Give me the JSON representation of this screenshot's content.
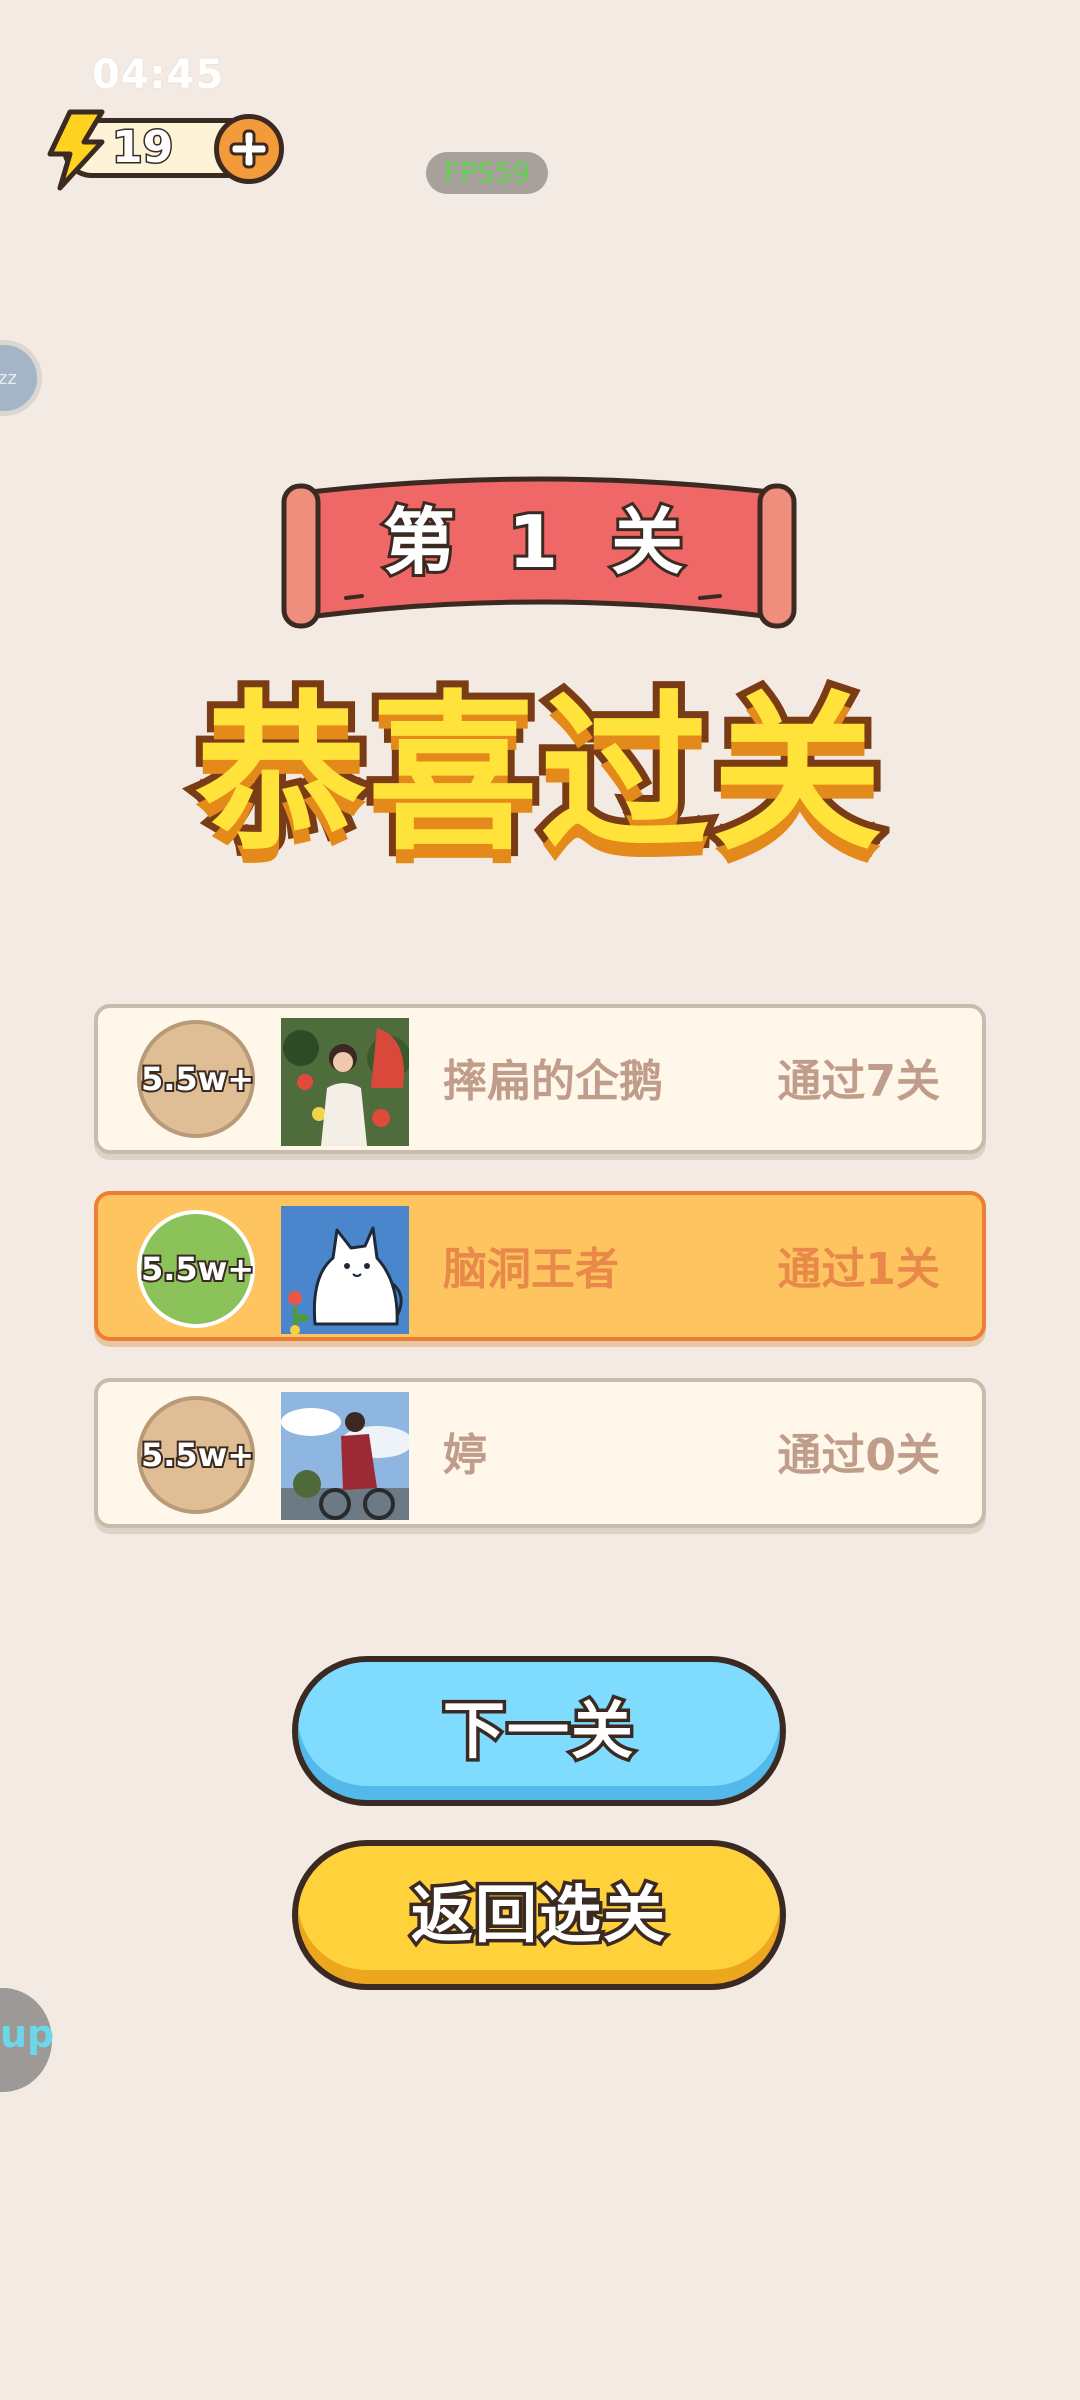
{
  "status_bar": {
    "time": "04:45"
  },
  "energy": {
    "value": "19"
  },
  "fps": {
    "label": "FPS59"
  },
  "edge_widgets": {
    "top_label": "zz",
    "bottom_label": "up"
  },
  "level": {
    "ribbon_text": "第 1 关",
    "title": "恭喜过关"
  },
  "leaderboard": [
    {
      "badge": "5.5w+",
      "name": "摔扁的企鹅",
      "result": "通过7关",
      "highlight": false,
      "avatar": "photo-woman-flowers"
    },
    {
      "badge": "5.5w+",
      "name": "脑洞王者",
      "result": "通过1关",
      "highlight": true,
      "avatar": "white-cat-illustration"
    },
    {
      "badge": "5.5w+",
      "name": "婷",
      "result": "通过0关",
      "highlight": false,
      "avatar": "photo-woman-bike"
    }
  ],
  "buttons": {
    "next": "下一关",
    "back": "返回选关"
  },
  "colors": {
    "background": "#f3ebe3",
    "ribbon": "#ef6766",
    "title_fill": "#ffe23a",
    "highlight_row": "#fec460",
    "next_button": "#7fdcff",
    "back_button": "#ffd23c"
  }
}
